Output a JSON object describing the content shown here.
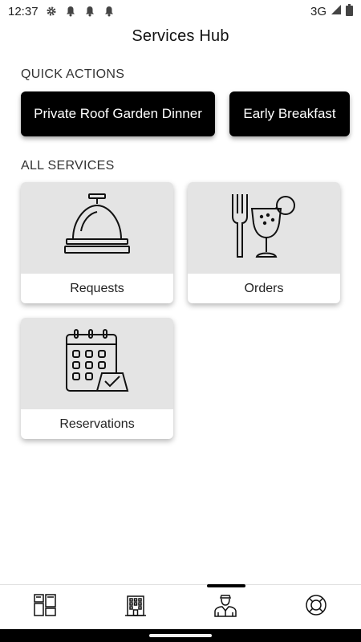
{
  "status_bar": {
    "time": "12:37",
    "network": "3G",
    "icons": [
      "gear-icon",
      "bell-icon",
      "bell-icon",
      "bell-icon",
      "signal-icon",
      "battery-icon"
    ]
  },
  "header": {
    "title": "Services Hub"
  },
  "quick_actions": {
    "label": "QUICK ACTIONS",
    "items": [
      {
        "label": "Private Roof Garden Dinner"
      },
      {
        "label": "Early Breakfast"
      }
    ]
  },
  "all_services": {
    "label": "ALL SERVICES",
    "cards": [
      {
        "label": "Requests",
        "icon": "service-bell-icon"
      },
      {
        "label": "Orders",
        "icon": "fork-and-drink-icon"
      },
      {
        "label": "Reservations",
        "icon": "calendar-reservation-icon"
      }
    ]
  },
  "bottom_nav": {
    "items": [
      {
        "icon": "dashboard-icon"
      },
      {
        "icon": "hotel-building-icon"
      },
      {
        "icon": "concierge-icon",
        "active": true
      },
      {
        "icon": "lifebuoy-icon"
      }
    ]
  }
}
